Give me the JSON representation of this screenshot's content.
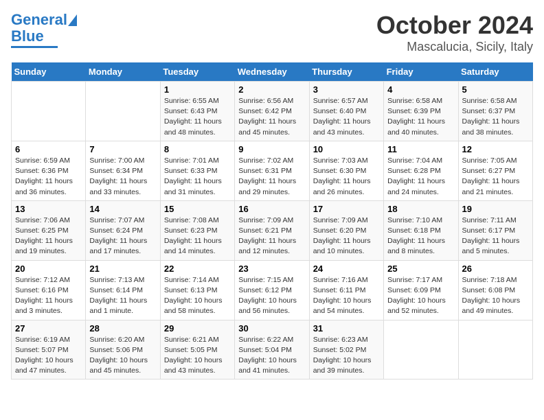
{
  "header": {
    "logo_line1": "General",
    "logo_line2": "Blue",
    "title": "October 2024",
    "subtitle": "Mascalucia, Sicily, Italy"
  },
  "days_of_week": [
    "Sunday",
    "Monday",
    "Tuesday",
    "Wednesday",
    "Thursday",
    "Friday",
    "Saturday"
  ],
  "weeks": [
    [
      {
        "num": "",
        "sunrise": "",
        "sunset": "",
        "daylight": ""
      },
      {
        "num": "",
        "sunrise": "",
        "sunset": "",
        "daylight": ""
      },
      {
        "num": "1",
        "sunrise": "Sunrise: 6:55 AM",
        "sunset": "Sunset: 6:43 PM",
        "daylight": "Daylight: 11 hours and 48 minutes."
      },
      {
        "num": "2",
        "sunrise": "Sunrise: 6:56 AM",
        "sunset": "Sunset: 6:42 PM",
        "daylight": "Daylight: 11 hours and 45 minutes."
      },
      {
        "num": "3",
        "sunrise": "Sunrise: 6:57 AM",
        "sunset": "Sunset: 6:40 PM",
        "daylight": "Daylight: 11 hours and 43 minutes."
      },
      {
        "num": "4",
        "sunrise": "Sunrise: 6:58 AM",
        "sunset": "Sunset: 6:39 PM",
        "daylight": "Daylight: 11 hours and 40 minutes."
      },
      {
        "num": "5",
        "sunrise": "Sunrise: 6:58 AM",
        "sunset": "Sunset: 6:37 PM",
        "daylight": "Daylight: 11 hours and 38 minutes."
      }
    ],
    [
      {
        "num": "6",
        "sunrise": "Sunrise: 6:59 AM",
        "sunset": "Sunset: 6:36 PM",
        "daylight": "Daylight: 11 hours and 36 minutes."
      },
      {
        "num": "7",
        "sunrise": "Sunrise: 7:00 AM",
        "sunset": "Sunset: 6:34 PM",
        "daylight": "Daylight: 11 hours and 33 minutes."
      },
      {
        "num": "8",
        "sunrise": "Sunrise: 7:01 AM",
        "sunset": "Sunset: 6:33 PM",
        "daylight": "Daylight: 11 hours and 31 minutes."
      },
      {
        "num": "9",
        "sunrise": "Sunrise: 7:02 AM",
        "sunset": "Sunset: 6:31 PM",
        "daylight": "Daylight: 11 hours and 29 minutes."
      },
      {
        "num": "10",
        "sunrise": "Sunrise: 7:03 AM",
        "sunset": "Sunset: 6:30 PM",
        "daylight": "Daylight: 11 hours and 26 minutes."
      },
      {
        "num": "11",
        "sunrise": "Sunrise: 7:04 AM",
        "sunset": "Sunset: 6:28 PM",
        "daylight": "Daylight: 11 hours and 24 minutes."
      },
      {
        "num": "12",
        "sunrise": "Sunrise: 7:05 AM",
        "sunset": "Sunset: 6:27 PM",
        "daylight": "Daylight: 11 hours and 21 minutes."
      }
    ],
    [
      {
        "num": "13",
        "sunrise": "Sunrise: 7:06 AM",
        "sunset": "Sunset: 6:25 PM",
        "daylight": "Daylight: 11 hours and 19 minutes."
      },
      {
        "num": "14",
        "sunrise": "Sunrise: 7:07 AM",
        "sunset": "Sunset: 6:24 PM",
        "daylight": "Daylight: 11 hours and 17 minutes."
      },
      {
        "num": "15",
        "sunrise": "Sunrise: 7:08 AM",
        "sunset": "Sunset: 6:23 PM",
        "daylight": "Daylight: 11 hours and 14 minutes."
      },
      {
        "num": "16",
        "sunrise": "Sunrise: 7:09 AM",
        "sunset": "Sunset: 6:21 PM",
        "daylight": "Daylight: 11 hours and 12 minutes."
      },
      {
        "num": "17",
        "sunrise": "Sunrise: 7:09 AM",
        "sunset": "Sunset: 6:20 PM",
        "daylight": "Daylight: 11 hours and 10 minutes."
      },
      {
        "num": "18",
        "sunrise": "Sunrise: 7:10 AM",
        "sunset": "Sunset: 6:18 PM",
        "daylight": "Daylight: 11 hours and 8 minutes."
      },
      {
        "num": "19",
        "sunrise": "Sunrise: 7:11 AM",
        "sunset": "Sunset: 6:17 PM",
        "daylight": "Daylight: 11 hours and 5 minutes."
      }
    ],
    [
      {
        "num": "20",
        "sunrise": "Sunrise: 7:12 AM",
        "sunset": "Sunset: 6:16 PM",
        "daylight": "Daylight: 11 hours and 3 minutes."
      },
      {
        "num": "21",
        "sunrise": "Sunrise: 7:13 AM",
        "sunset": "Sunset: 6:14 PM",
        "daylight": "Daylight: 11 hours and 1 minute."
      },
      {
        "num": "22",
        "sunrise": "Sunrise: 7:14 AM",
        "sunset": "Sunset: 6:13 PM",
        "daylight": "Daylight: 10 hours and 58 minutes."
      },
      {
        "num": "23",
        "sunrise": "Sunrise: 7:15 AM",
        "sunset": "Sunset: 6:12 PM",
        "daylight": "Daylight: 10 hours and 56 minutes."
      },
      {
        "num": "24",
        "sunrise": "Sunrise: 7:16 AM",
        "sunset": "Sunset: 6:11 PM",
        "daylight": "Daylight: 10 hours and 54 minutes."
      },
      {
        "num": "25",
        "sunrise": "Sunrise: 7:17 AM",
        "sunset": "Sunset: 6:09 PM",
        "daylight": "Daylight: 10 hours and 52 minutes."
      },
      {
        "num": "26",
        "sunrise": "Sunrise: 7:18 AM",
        "sunset": "Sunset: 6:08 PM",
        "daylight": "Daylight: 10 hours and 49 minutes."
      }
    ],
    [
      {
        "num": "27",
        "sunrise": "Sunrise: 6:19 AM",
        "sunset": "Sunset: 5:07 PM",
        "daylight": "Daylight: 10 hours and 47 minutes."
      },
      {
        "num": "28",
        "sunrise": "Sunrise: 6:20 AM",
        "sunset": "Sunset: 5:06 PM",
        "daylight": "Daylight: 10 hours and 45 minutes."
      },
      {
        "num": "29",
        "sunrise": "Sunrise: 6:21 AM",
        "sunset": "Sunset: 5:05 PM",
        "daylight": "Daylight: 10 hours and 43 minutes."
      },
      {
        "num": "30",
        "sunrise": "Sunrise: 6:22 AM",
        "sunset": "Sunset: 5:04 PM",
        "daylight": "Daylight: 10 hours and 41 minutes."
      },
      {
        "num": "31",
        "sunrise": "Sunrise: 6:23 AM",
        "sunset": "Sunset: 5:02 PM",
        "daylight": "Daylight: 10 hours and 39 minutes."
      },
      {
        "num": "",
        "sunrise": "",
        "sunset": "",
        "daylight": ""
      },
      {
        "num": "",
        "sunrise": "",
        "sunset": "",
        "daylight": ""
      }
    ]
  ]
}
